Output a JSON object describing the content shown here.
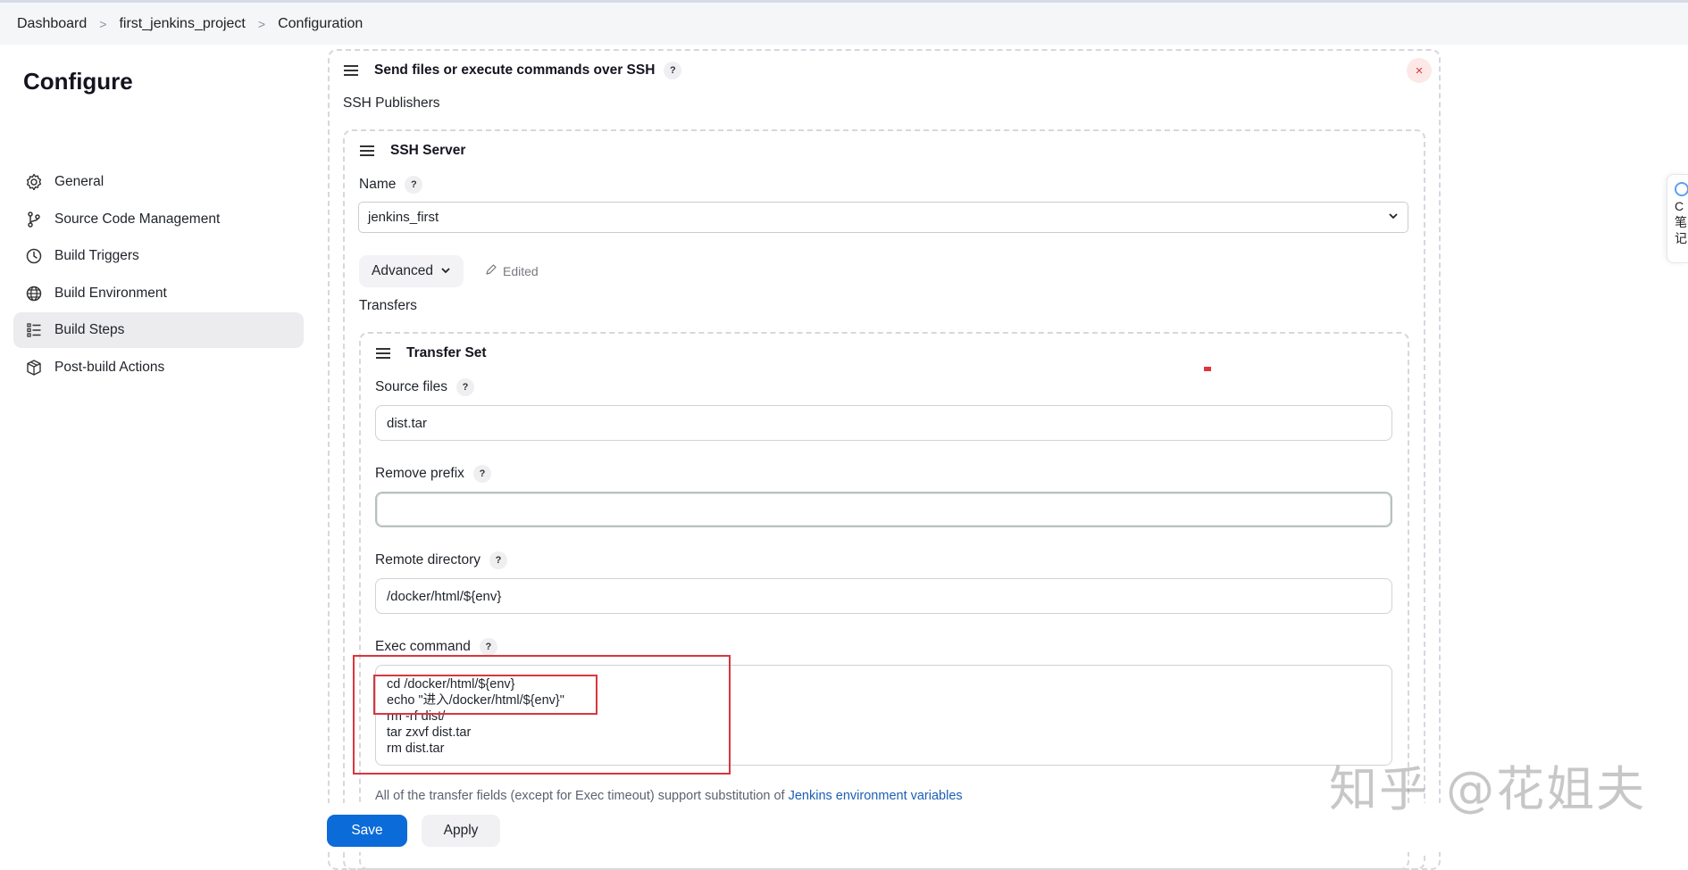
{
  "breadcrumb": [
    "Dashboard",
    "first_jenkins_project",
    "Configuration"
  ],
  "sidebar": {
    "title": "Configure",
    "items": [
      {
        "label": "General",
        "icon": "gear-icon"
      },
      {
        "label": "Source Code Management",
        "icon": "branch-icon"
      },
      {
        "label": "Build Triggers",
        "icon": "clock-icon"
      },
      {
        "label": "Build Environment",
        "icon": "globe-icon"
      },
      {
        "label": "Build Steps",
        "icon": "list-icon",
        "active": true
      },
      {
        "label": "Post-build Actions",
        "icon": "package-icon"
      }
    ]
  },
  "step": {
    "title": "Send files or execute commands over SSH",
    "help": "?",
    "close": "×",
    "publishers_label": "SSH Publishers",
    "server": {
      "title": "SSH Server",
      "name_label": "Name",
      "name_value": "jenkins_first",
      "advanced_label": "Advanced",
      "edited_label": "Edited",
      "transfers_label": "Transfers",
      "transfer_set": {
        "title": "Transfer Set",
        "source_files_label": "Source files",
        "source_files_value": "dist.tar",
        "remove_prefix_label": "Remove prefix",
        "remove_prefix_value": "",
        "remote_directory_label": "Remote directory",
        "remote_directory_value": "/docker/html/${env}",
        "exec_command_label": "Exec command",
        "exec_command_lines": [
          "cd /docker/html/${env}",
          "echo \"进入/docker/html/${env}\"",
          "rm -rf dist/",
          "tar zxvf dist.tar",
          "rm dist.tar"
        ]
      }
    },
    "note_text": "All of the transfer fields (except for Exec timeout) support substitution of ",
    "note_link": "Jenkins environment variables"
  },
  "buttons": {
    "save": "Save",
    "apply": "Apply"
  },
  "watermark": "知乎 @花姐夫",
  "side_widget_text": [
    "C",
    "笔",
    "记"
  ],
  "colors": {
    "primary": "#0b6bd9",
    "danger": "#d9363e",
    "active_nav": "#ececee"
  }
}
